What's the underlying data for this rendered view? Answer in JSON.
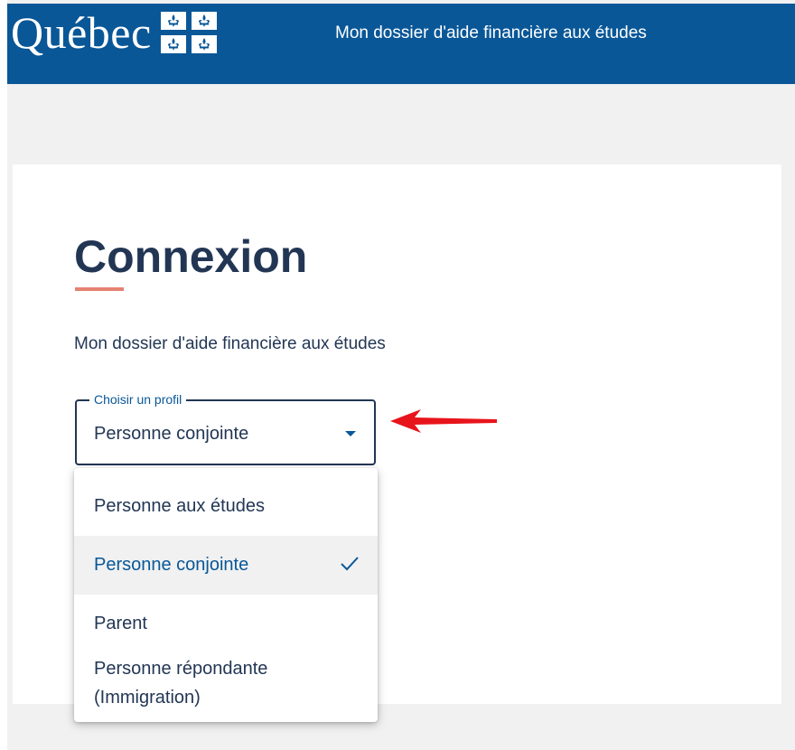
{
  "header": {
    "logo_text": "Québec",
    "title": "Mon dossier d'aide financière aux études"
  },
  "login": {
    "title": "Connexion",
    "subtitle": "Mon dossier d'aide financière aux études"
  },
  "profile_select": {
    "legend": "Choisir un profil",
    "selected_value": "Personne conjointe",
    "options": [
      {
        "label": "Personne aux études",
        "selected": false
      },
      {
        "label": "Personne conjointe",
        "selected": true
      },
      {
        "label": "Parent",
        "selected": false
      },
      {
        "label": "Personne répondante (Immigration)",
        "selected": false
      }
    ]
  },
  "icons": {
    "logo_flag": "fleurdelise-flag-icon",
    "caret": "caret-down-icon",
    "check": "checkmark-icon",
    "annotation": "red-arrow-icon"
  },
  "colors": {
    "header_bg": "#095797",
    "page_bg": "#f1f1f2",
    "title_text": "#223654",
    "title_underline": "#e58271",
    "accent_blue": "#095797",
    "annotation_arrow": "#e8141b"
  }
}
